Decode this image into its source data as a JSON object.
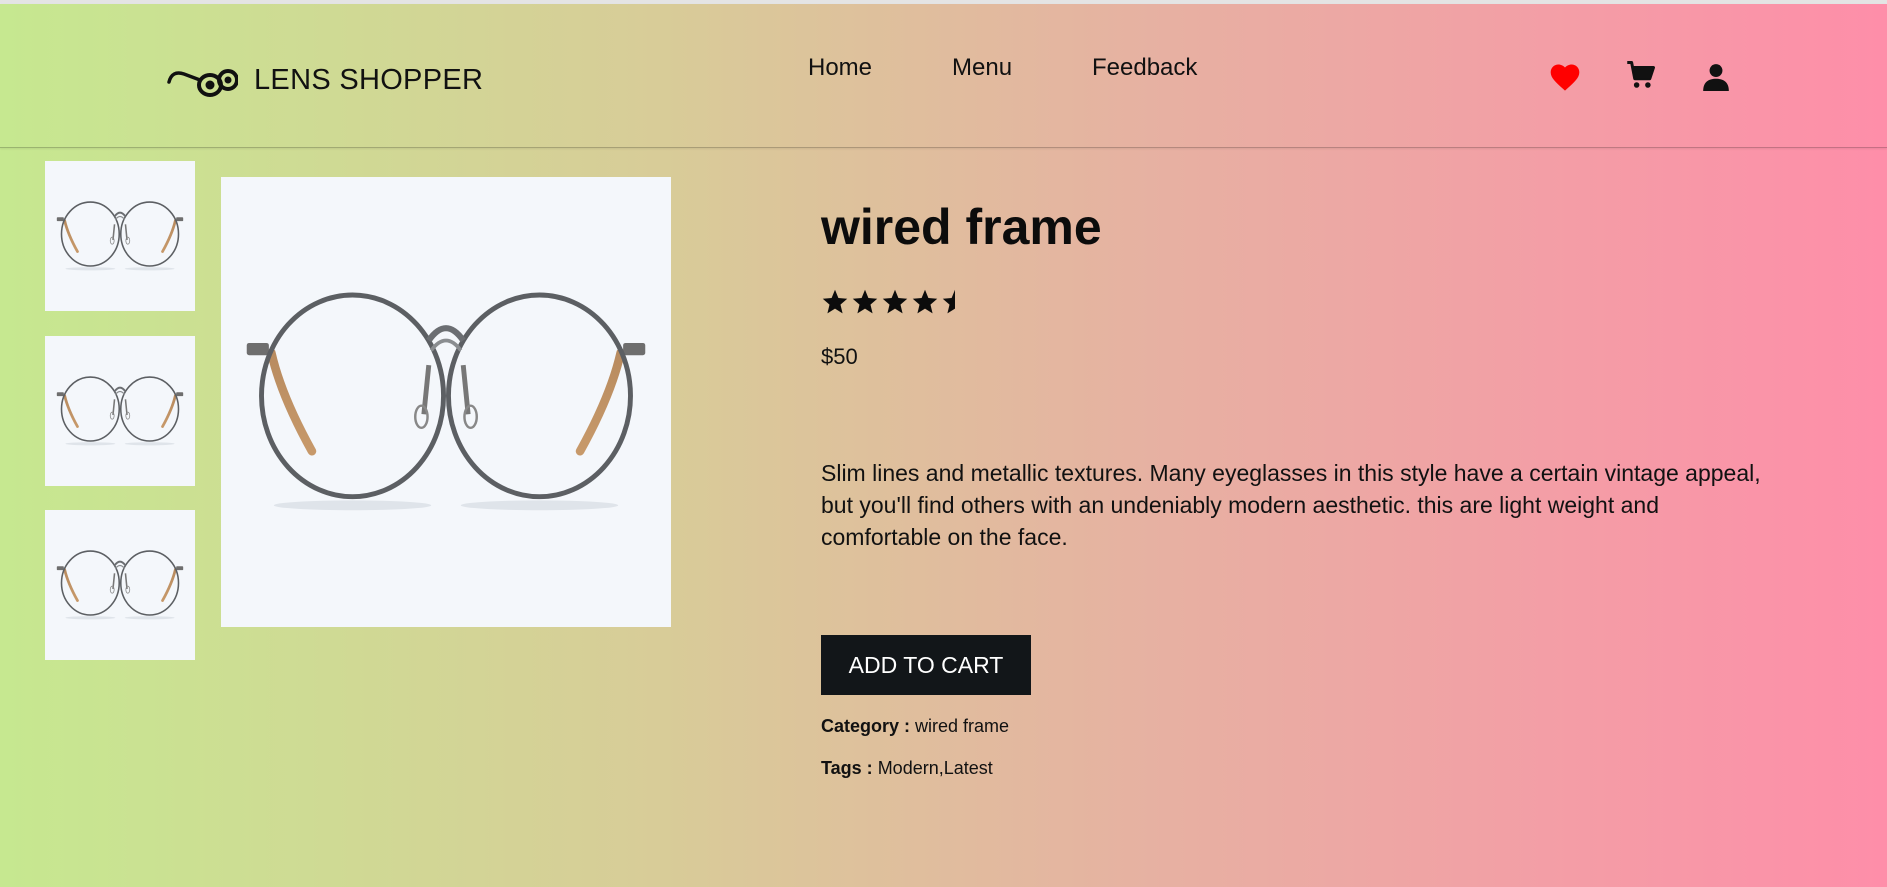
{
  "brand": {
    "name": "LENS SHOPPER",
    "logo_icon": "glasses-icon"
  },
  "nav": [
    {
      "label": "Home"
    },
    {
      "label": "Menu"
    },
    {
      "label": "Feedback"
    }
  ],
  "header_icons": [
    {
      "name": "heart-icon",
      "color": "#ff0000"
    },
    {
      "name": "cart-icon",
      "color": "#111111"
    },
    {
      "name": "user-icon",
      "color": "#111111"
    }
  ],
  "gallery": {
    "thumbnails": [
      "wired-frame-glasses-image",
      "wired-frame-glasses-image",
      "wired-frame-glasses-image"
    ],
    "main_image": "wired-frame-glasses-image"
  },
  "product": {
    "title": "wired frame",
    "rating": 4.5,
    "rating_max": 5,
    "price": "$50",
    "description": "Slim lines and metallic textures. Many eyeglasses in this style have a certain vintage appeal, but you'll find others with an undeniably modern aesthetic. this are light weight and comfortable on the face.",
    "add_to_cart_label": "ADD TO CART",
    "category_label": "Category :",
    "category_value": "wired frame",
    "tags_label": "Tags :",
    "tags_value": "Modern,Latest"
  },
  "colors": {
    "gradient_start": "#c6e890",
    "gradient_end": "#fe8ea9",
    "button_bg": "#121619",
    "heart": "#ff0000"
  }
}
